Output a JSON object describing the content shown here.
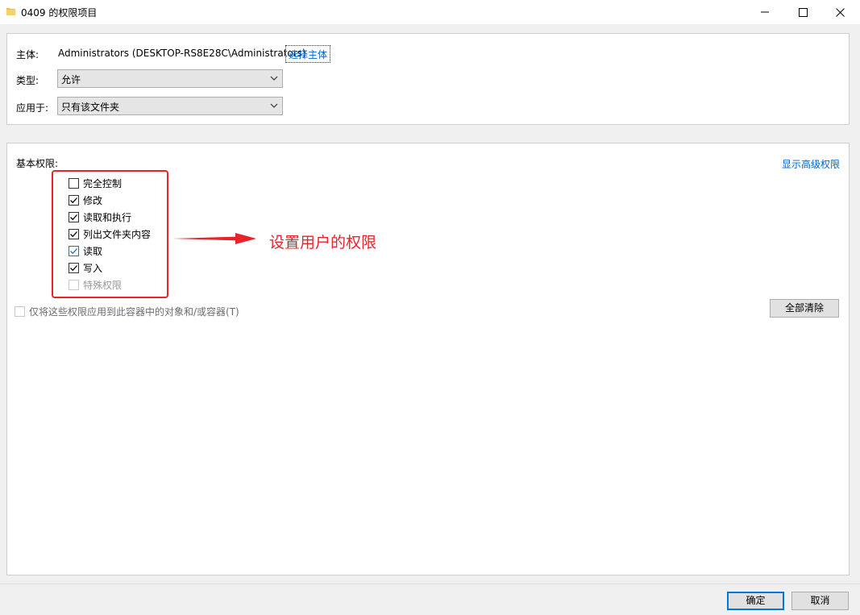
{
  "window": {
    "title": "0409 的权限项目"
  },
  "principal": {
    "label": "主体:",
    "value": "Administrators (DESKTOP-RS8E28C\\Administrators)",
    "select_link": "选择主体"
  },
  "type": {
    "label": "类型:",
    "selected": "允许"
  },
  "applies_to": {
    "label": "应用于:",
    "selected": "只有该文件夹"
  },
  "basic_permissions": {
    "heading": "基本权限:",
    "advanced_link": "显示高级权限",
    "items": [
      {
        "label": "完全控制",
        "checked": false,
        "disabled": false
      },
      {
        "label": "修改",
        "checked": true,
        "disabled": false
      },
      {
        "label": "读取和执行",
        "checked": true,
        "disabled": false
      },
      {
        "label": "列出文件夹内容",
        "checked": true,
        "disabled": false
      },
      {
        "label": "读取",
        "checked": true,
        "disabled": false
      },
      {
        "label": "写入",
        "checked": true,
        "disabled": false
      },
      {
        "label": "特殊权限",
        "checked": false,
        "disabled": true
      }
    ],
    "apply_only_label": "仅将这些权限应用到此容器中的对象和/或容器(T)",
    "clear_all_button": "全部清除"
  },
  "annotation": {
    "text": "设置用户的权限",
    "color": "#e8242a"
  },
  "footer": {
    "ok_button": "确定",
    "cancel_button": "取消"
  }
}
